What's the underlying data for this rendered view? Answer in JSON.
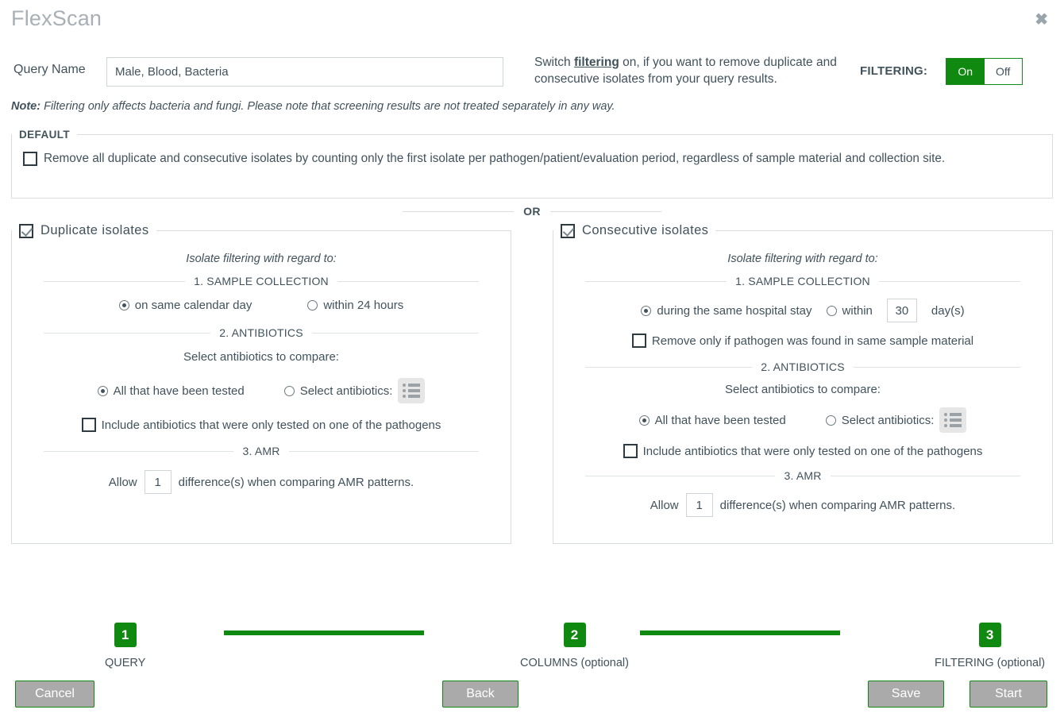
{
  "header": {
    "app_title": "FlexScan",
    "close_icon": "close-icon"
  },
  "query": {
    "label": "Query Name",
    "value": "Male, Blood, Bacteria",
    "placeholder": ""
  },
  "filtering_switch": {
    "description_pre": "Switch ",
    "description_link": "filtering",
    "description_post": " on, if you want to remove duplicate and consecutive isolates from your query results.",
    "label": "FILTERING:",
    "on_label": "On",
    "off_label": "Off",
    "state": "On",
    "on_color": "#108910"
  },
  "note": {
    "prefix": "Note:",
    "text": " Filtering only affects bacteria and fungi. Please note that screening results are not treated separately in any way."
  },
  "default_section": {
    "legend": "DEFAULT",
    "checkbox_label": "Remove all duplicate and consecutive isolates by counting only the first isolate per pathogen/patient/evaluation period, regardless of sample material and collection site.",
    "checked": false
  },
  "or_divider": {
    "text": "OR"
  },
  "duplicate_panel": {
    "title": "Duplicate isolates",
    "checked": true,
    "subtitle": "Isolate filtering with regard to:",
    "section1": {
      "heading": "1. SAMPLE COLLECTION",
      "option_a": "on same calendar day",
      "option_a_selected": true,
      "option_b": "within 24 hours",
      "option_b_selected": false
    },
    "section2": {
      "heading": "2. ANTIBIOTICS",
      "prompt": "Select antibiotics to compare:",
      "option_a": "All that have been tested",
      "option_a_selected": true,
      "option_b": "Select antibiotics:",
      "option_b_selected": false,
      "list_icon": "list-icon",
      "include_label": "Include antibiotics that were only tested on one of the pathogens",
      "include_checked": false
    },
    "section3": {
      "heading": "3. AMR",
      "allow_prefix": "Allow",
      "allow_value": "1",
      "allow_suffix": "difference(s) when comparing AMR patterns."
    }
  },
  "consecutive_panel": {
    "title": "Consecutive isolates",
    "checked": true,
    "subtitle": "Isolate filtering with regard to:",
    "section1": {
      "heading": "1. SAMPLE COLLECTION",
      "option_a": "during the same hospital stay",
      "option_a_selected": true,
      "option_b": "within",
      "option_b_selected": false,
      "days_value": "30",
      "days_unit": "day(s)",
      "same_material_label": "Remove only if pathogen was found in same sample material",
      "same_material_checked": false
    },
    "section2": {
      "heading": "2. ANTIBIOTICS",
      "prompt": "Select antibiotics to compare:",
      "option_a": "All that have been tested",
      "option_a_selected": true,
      "option_b": "Select antibiotics:",
      "option_b_selected": false,
      "list_icon": "list-icon",
      "include_label": "Include antibiotics that were only tested on one of the pathogens",
      "include_checked": false
    },
    "section3": {
      "heading": "3. AMR",
      "allow_prefix": "Allow",
      "allow_value": "1",
      "allow_suffix": "difference(s) when comparing AMR patterns."
    }
  },
  "stepper": {
    "steps": [
      {
        "number": "1",
        "caption": "QUERY"
      },
      {
        "number": "2",
        "caption": "COLUMNS (optional)"
      },
      {
        "number": "3",
        "caption": "FILTERING (optional)"
      }
    ],
    "accent_color": "#108910"
  },
  "buttons": {
    "cancel": "Cancel",
    "back": "Back",
    "save": "Save",
    "start": "Start"
  }
}
